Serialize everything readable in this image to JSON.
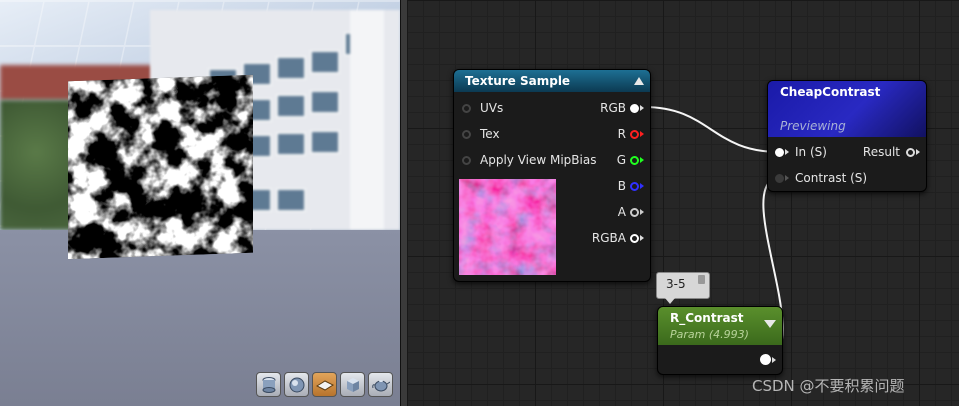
{
  "viewport": {
    "toolbar": [
      {
        "icon": "cylinder-icon",
        "active": false
      },
      {
        "icon": "sphere-icon",
        "active": false
      },
      {
        "icon": "plane-icon",
        "active": true
      },
      {
        "icon": "cube-icon",
        "active": false
      },
      {
        "icon": "teapot-icon",
        "active": false
      }
    ]
  },
  "texture_sample": {
    "title": "Texture Sample",
    "inputs": [
      "UVs",
      "Tex",
      "Apply View MipBias"
    ],
    "outputs": [
      {
        "label": "RGB",
        "color": "#ffffff",
        "connected": true
      },
      {
        "label": "R",
        "color": "#ff2020",
        "connected": false
      },
      {
        "label": "G",
        "color": "#20ff20",
        "connected": false
      },
      {
        "label": "B",
        "color": "#3030ff",
        "connected": false
      },
      {
        "label": "A",
        "color": "#cccccc",
        "connected": false
      },
      {
        "label": "RGBA",
        "color": "#ffffff",
        "connected": false
      }
    ]
  },
  "cheap_contrast": {
    "title": "CheapContrast",
    "subtitle": "Previewing",
    "inputs": [
      "In (S)",
      "Contrast (S)"
    ],
    "output": "Result"
  },
  "r_contrast": {
    "title": "R_Contrast",
    "subtitle": "Param (4.993)"
  },
  "comment_bubble": {
    "text": "3-5"
  },
  "watermark": "CSDN @不要积累问题"
}
